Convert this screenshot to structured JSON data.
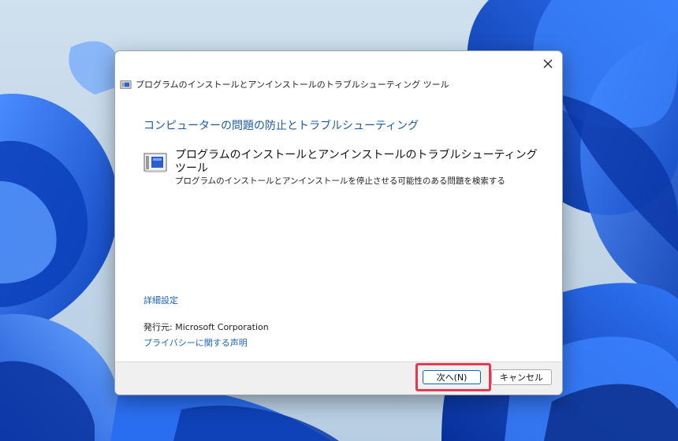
{
  "window": {
    "title": "プログラムのインストールとアンインストールのトラブルシューティング ツール",
    "close_icon": "close-icon"
  },
  "content": {
    "heading": "コンピューターの問題の防止とトラブルシューティング",
    "tool": {
      "icon": "troubleshooter-icon",
      "title": "プログラムのインストールとアンインストールのトラブルシューティング ツール",
      "description": "プログラムのインストールとアンインストールを停止させる可能性のある問題を検索する"
    },
    "advanced_link": "詳細設定",
    "publisher": "発行元:  Microsoft Corporation",
    "privacy_link": "プライバシーに関する声明"
  },
  "footer": {
    "next_label": "次へ(N)",
    "cancel_label": "キャンセル",
    "highlight_color": "#e8384f"
  },
  "colors": {
    "accent": "#1c5aa6",
    "link": "#1c64b8",
    "wallpaper_blue": "#1f5fd9"
  }
}
